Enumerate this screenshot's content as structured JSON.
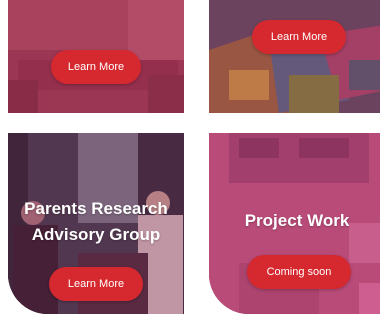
{
  "cards": [
    {
      "title": "",
      "button_label": "Learn More"
    },
    {
      "title": "",
      "button_label": "Learn More"
    },
    {
      "title_line1": "Parents Research",
      "title_line2": "Advisory Group",
      "button_label": "Learn More"
    },
    {
      "title": "Project Work",
      "button_label": "Coming soon"
    }
  ],
  "colors": {
    "accent": "#d6282f",
    "overlay_pink": "#c4345c",
    "text": "#ffffff"
  }
}
